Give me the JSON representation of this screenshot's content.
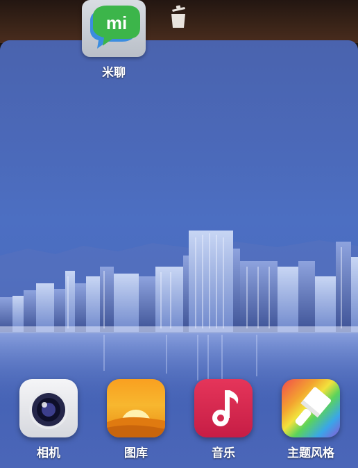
{
  "dragged_app": {
    "label": "米聊",
    "icon": "mi-chat-icon",
    "badge_text": "mi"
  },
  "topbar": {
    "icon": "trash-icon"
  },
  "dock": [
    {
      "label": "相机",
      "icon": "camera-icon"
    },
    {
      "label": "图库",
      "icon": "gallery-icon"
    },
    {
      "label": "音乐",
      "icon": "music-icon"
    },
    {
      "label": "主题风格",
      "icon": "theme-brush-icon"
    }
  ],
  "colors": {
    "wallpaper_sky": "#4b69b9",
    "mi_green": "#3cb54a",
    "music_red": "#d42a50",
    "gallery_orange": "#f7a826"
  }
}
